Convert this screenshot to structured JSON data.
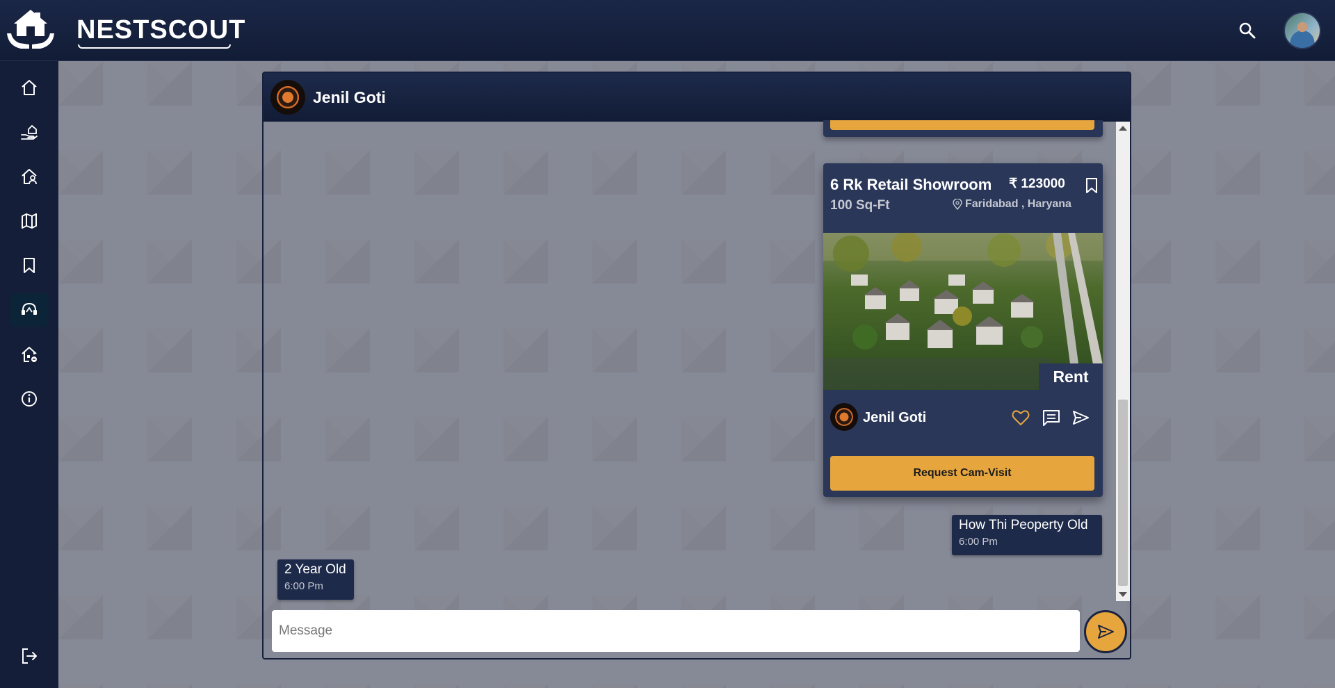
{
  "header": {
    "brand": "NESTSCOUT"
  },
  "sidebar": {
    "items": [
      {
        "icon": "home-icon"
      },
      {
        "icon": "hand-home-icon"
      },
      {
        "icon": "home-user-icon"
      },
      {
        "icon": "map-icon"
      },
      {
        "icon": "bookmark-icon"
      },
      {
        "icon": "support-chat-icon",
        "active": true
      },
      {
        "icon": "home-settings-icon"
      },
      {
        "icon": "info-icon"
      },
      {
        "icon": "logout-icon"
      }
    ]
  },
  "chat": {
    "contact_name": "Jenil Goti",
    "property_card": {
      "title": "6 Rk Retail Showroom",
      "area": "100 Sq-Ft",
      "price": "₹ 123000",
      "location": "Faridabad , Haryana",
      "listing_type": "Rent",
      "owner_name": "Jenil Goti",
      "cta_label": "Request Cam-Visit"
    },
    "messages": [
      {
        "side": "right",
        "text": "How Thi Peoperty Old",
        "time": "6:00 Pm"
      },
      {
        "side": "left",
        "text": "2 Year Old",
        "time": "6:00 Pm"
      }
    ],
    "input": {
      "placeholder": "Message",
      "value": ""
    }
  },
  "colors": {
    "navy": "#141e38",
    "accent": "#e7a63d",
    "card": "#2a3759"
  }
}
